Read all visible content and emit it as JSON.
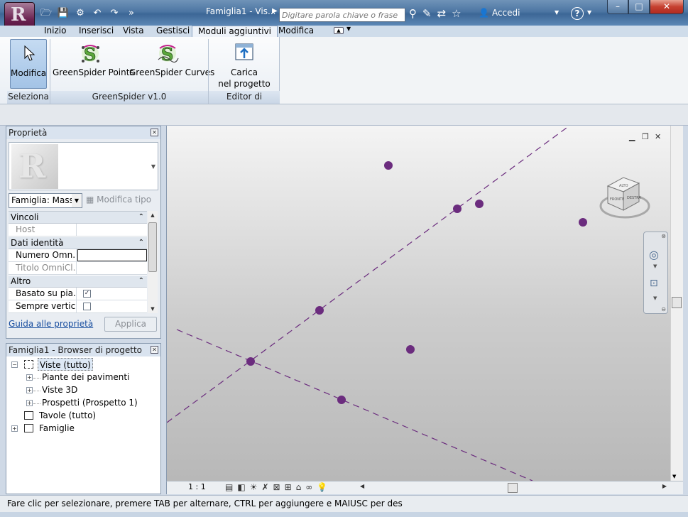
{
  "app": {
    "title": "Famiglia1 - Vis...",
    "app_button_letter": "R"
  },
  "search": {
    "placeholder": "Digitare parola chiave o frase"
  },
  "account": {
    "label": "Accedi"
  },
  "help": {
    "label": "?"
  },
  "tabs": [
    {
      "label": "Inizio"
    },
    {
      "label": "Inserisci"
    },
    {
      "label": "Vista"
    },
    {
      "label": "Gestisci"
    },
    {
      "label": "Moduli aggiuntivi",
      "active": true
    },
    {
      "label": "Modifica"
    }
  ],
  "ribbon": {
    "modifica_label": "Modifica",
    "gs_points_label": "GreenSpider Points",
    "gs_curves_label": "GreenSpider Curves",
    "carica_line1": "Carica",
    "carica_line2": "nel progetto",
    "panel_seleziona": "Seleziona",
    "panel_greenspider": "GreenSpider v1.0",
    "panel_editor": "Editor di famiglie"
  },
  "properties": {
    "title": "Proprietà",
    "family_select": "Famiglia: Massa",
    "modifica_tipo": "Modifica tipo",
    "categories": [
      {
        "label": "Vincoli",
        "rows": [
          {
            "key": "Host",
            "dim": true,
            "value": ""
          }
        ]
      },
      {
        "label": "Dati identità",
        "rows": [
          {
            "key": "Numero Omn...",
            "dim": false,
            "value": ""
          },
          {
            "key": "Titolo OmniCl...",
            "dim": true,
            "value": ""
          }
        ]
      },
      {
        "label": "Altro",
        "rows": [
          {
            "key": "Basato su pia...",
            "dim": false,
            "checked": true
          },
          {
            "key": "Sempre vertic...",
            "dim": false,
            "checked": false
          }
        ]
      }
    ],
    "help_link": "Guida alle proprietà",
    "apply_label": "Applica"
  },
  "browser": {
    "title": "Famiglia1 - Browser di progetto",
    "items": [
      {
        "label": "Viste (tutto)"
      },
      {
        "label": "Piante dei pavimenti"
      },
      {
        "label": "Viste 3D"
      },
      {
        "label": "Prospetti (Prospetto 1)"
      },
      {
        "label": "Tavole (tutto)"
      },
      {
        "label": "Famiglie"
      }
    ]
  },
  "viewcube": {
    "top": "ALTO",
    "front": "FRONTE",
    "right": "DESTRA"
  },
  "viewbar": {
    "scale": "1 : 1"
  },
  "status": {
    "text": "Fare clic per selezionare, premere TAB per alternare, CTRL per aggiungere e MAIUSC per des"
  },
  "colors": {
    "point": "#6b2c7e",
    "accent": "#4d76a3"
  }
}
